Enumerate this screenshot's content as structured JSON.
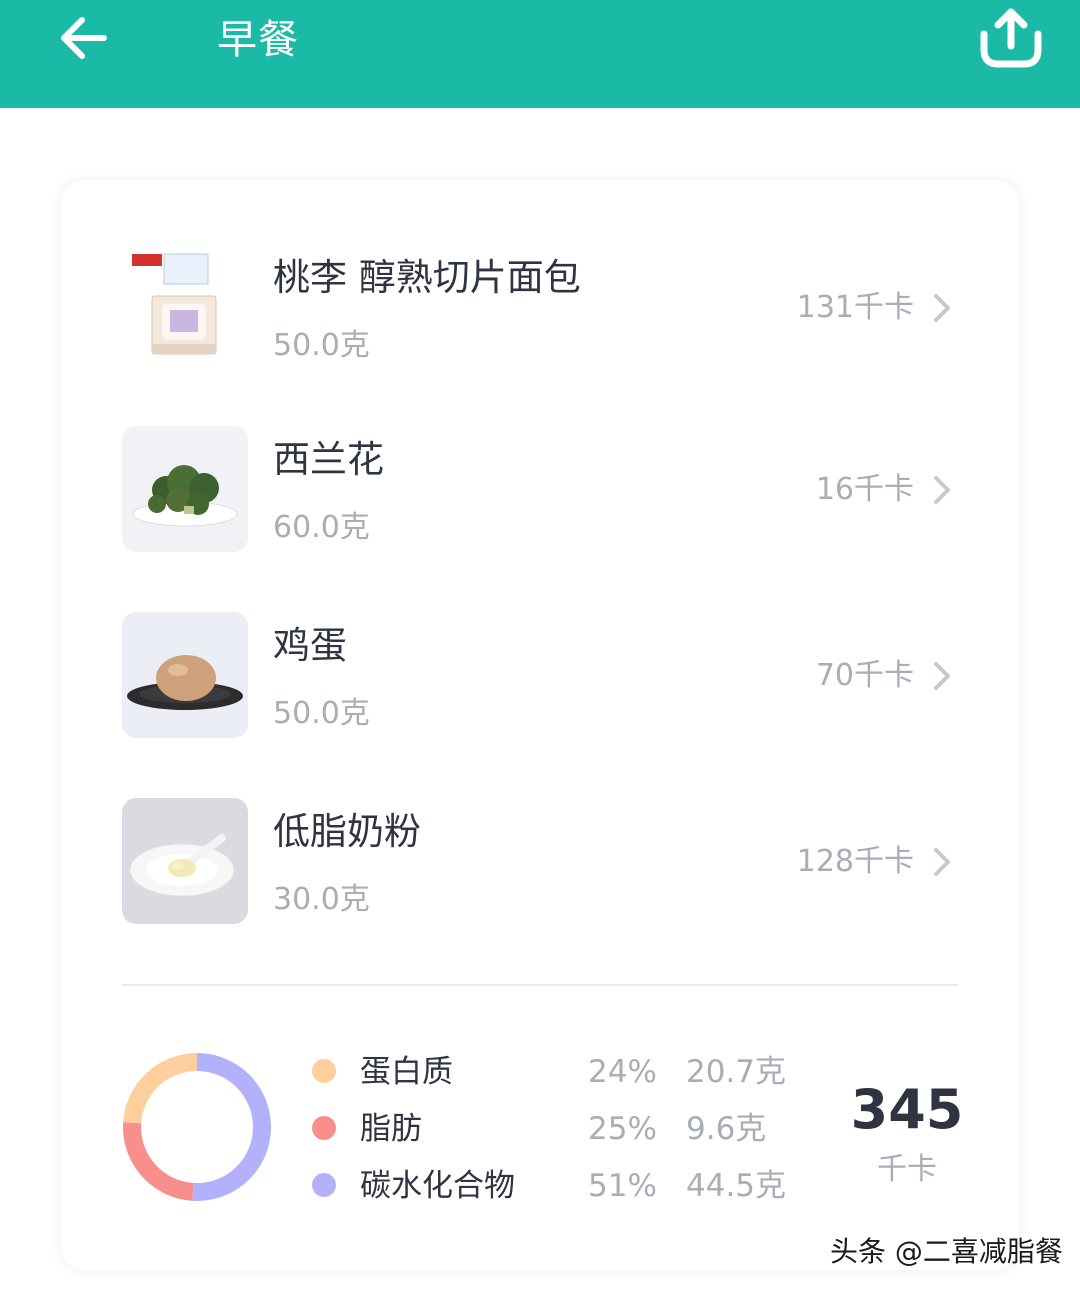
{
  "header": {
    "title": "早餐",
    "background_color": "#1bbaa7",
    "back_icon": "arrow-left-icon",
    "share_icon": "share-upload-icon"
  },
  "foods": [
    {
      "name": "桃李 醇熟切片面包",
      "weight": "50.0克",
      "calories": "131千卡",
      "image": "sliced-bread-package"
    },
    {
      "name": "西兰花",
      "weight": "60.0克",
      "calories": "16千卡",
      "image": "broccoli-plate"
    },
    {
      "name": "鸡蛋",
      "weight": "50.0克",
      "calories": "70千卡",
      "image": "egg-on-dish"
    },
    {
      "name": "低脂奶粉",
      "weight": "30.0克",
      "calories": "128千卡",
      "image": "milk-powder-plate"
    }
  ],
  "nutrition": {
    "macros": [
      {
        "name": "蛋白质",
        "percent": "24%",
        "grams": "20.7克",
        "color": "#fdcf9c"
      },
      {
        "name": "脂肪",
        "percent": "25%",
        "grams": "9.6克",
        "color": "#f7908d"
      },
      {
        "name": "碳水化合物",
        "percent": "51%",
        "grams": "44.5克",
        "color": "#b3b1fb"
      }
    ],
    "total": "345",
    "total_unit": "千卡",
    "chart_shares": [
      0.24,
      0.25,
      0.51
    ]
  },
  "watermark": "头条 @二喜减脂餐"
}
